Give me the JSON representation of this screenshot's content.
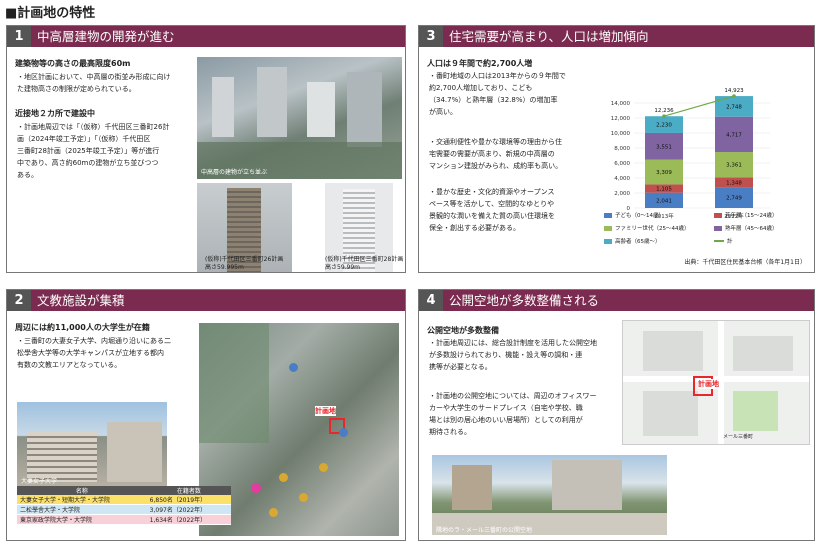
{
  "page_title": "■計画地の特性",
  "sections": [
    {
      "num": "1",
      "title": "中高層建物の開発が進む",
      "h1": "建築物等の高さの最高限度60m",
      "b1": [
        "・地区計画において、中高層の街並み形成に向け",
        "た建物高さの制限が定められている。"
      ],
      "h2": "近接地２カ所で建設中",
      "b2": [
        "・計画地周辺では「（仮称）千代田区三番町26計",
        "画（2024年竣工予定）」「（仮称）千代田区",
        "三番町28計画（2025年竣工予定）」等が進行",
        "中であり、高さ約60mの建物が立ち並びつつ",
        "ある。"
      ],
      "photo_caption": "中高層の建物が立ち並ぶ",
      "cap_a": [
        "(仮称)千代田区三番町26計画",
        "高さ59.995m"
      ],
      "cap_b": [
        "(仮称)千代田区三番町28計画",
        "高さ59.99m"
      ]
    },
    {
      "num": "2",
      "title": "文教施設が集積",
      "h1": "周辺には約11,000人の大学生が在籍",
      "b1": [
        "・三番町の大妻女子大学、内堀通り沿いにある二",
        "松學舎大学等の大学キャンパスが立地する都内",
        "有数の文教エリアとなっている。"
      ],
      "photo_caption": "大妻女子大学",
      "map_label": "計画地",
      "table_headers": [
        "名称",
        "在籍者数"
      ],
      "table_rows": [
        [
          "大妻女子大学・短期大学・大学院",
          "6,850名（2019年）"
        ],
        [
          "二松學舎大学・大学院",
          "3,097名（2022年）"
        ],
        [
          "東京家政学院大学・大学院",
          "1,634名（2022年）"
        ]
      ]
    },
    {
      "num": "3",
      "title": "住宅需要が高まり、人口は増加傾向",
      "h1": "人口は９年間で約2,700人増",
      "b1": [
        "・番町地域の人口は2013年からの９年間で",
        "約2,700人増加しており、こども",
        "（34.7%）と熟年層（32.8%）の増加率",
        "が高い。"
      ],
      "b2": [
        "・交通利便性や豊かな環境等の理由から住",
        "宅需要の需要が高まり、新規の中高層の",
        "マンション建設がみられ、成約率も高い。"
      ],
      "b3": [
        "・豊かな歴史・文化的資源やオープンス",
        "ペース等を活かして、空間的なゆとりや",
        "景観的な潤いを備えた質の高い住環境を",
        "保全・創出する必要がある。"
      ],
      "source": "出典：千代田区住民基本台帳（各年1月1日）"
    },
    {
      "num": "4",
      "title": "公開空地が多数整備される",
      "h1": "公開空地が多数整備",
      "b1": [
        "・計画地周辺には、総合設計制度を活用した公開空地",
        "が多数設けられており、機能・設え等の調和・連",
        "携等が必要となる。"
      ],
      "b2": [
        "・計画地の公開空地については、周辺のオフィスワー",
        "カーや大学生のサードプレイス（自宅や学校、職",
        "場とは別の居心地のいい居場所）としての利用が",
        "期待される。"
      ],
      "map_label": "計画地",
      "map_tag1": "メール三番町",
      "photo_caption": "隣地のラ・メール三番町の公開空地"
    }
  ],
  "chart_data": {
    "type": "bar",
    "categories": [
      "2013年",
      "2022年"
    ],
    "ylim": [
      0,
      16000
    ],
    "yticks": [
      "0",
      "2,000",
      "4,000",
      "6,000",
      "8,000",
      "10,000",
      "12,000",
      "14,000"
    ],
    "series": [
      {
        "name": "子ども（0〜14歳）",
        "color": "#4a7ec4",
        "values": [
          2041,
          2749
        ]
      },
      {
        "name": "若年層（15〜24歳）",
        "color": "#c0504d",
        "values": [
          1105,
          1348
        ]
      },
      {
        "name": "ファミリー世代（25〜44歳）",
        "color": "#9bbb59",
        "values": [
          3309,
          3361
        ]
      },
      {
        "name": "熟年層（45〜64歳）",
        "color": "#8064a2",
        "values": [
          3551,
          4717
        ]
      },
      {
        "name": "高齢者（65歳〜）",
        "color": "#4bacc6",
        "values": [
          2230,
          2748
        ]
      }
    ],
    "total": {
      "name": "計",
      "color": "#70a845",
      "values": [
        12236,
        14923
      ],
      "labels": [
        "12,236",
        "14,923"
      ]
    },
    "value_labels": [
      [
        "2,041",
        "1,105",
        "3,309",
        "3,551",
        "2,230"
      ],
      [
        "2,749",
        "1,348",
        "3,361",
        "4,717",
        "2,748"
      ]
    ]
  }
}
